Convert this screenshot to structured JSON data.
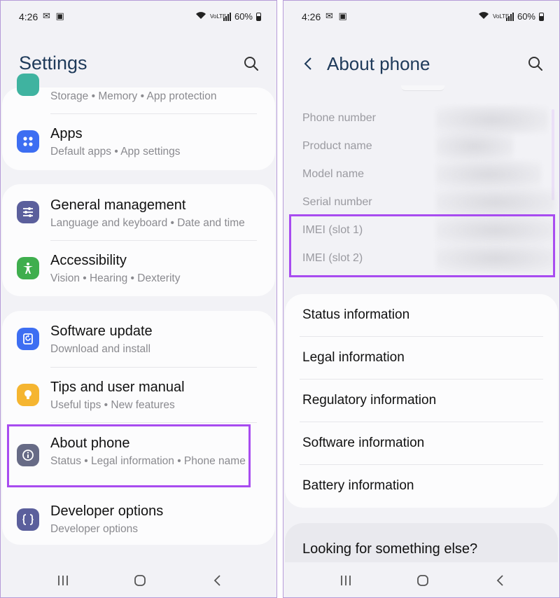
{
  "status_bar": {
    "time": "4:26",
    "notif_icons": "✉ ▣",
    "volte": "VoLTE",
    "battery": "60%"
  },
  "left": {
    "title": "Settings",
    "items": [
      {
        "subtitle": "Storage  •  Memory  •  App protection"
      },
      {
        "title": "Apps",
        "subtitle": "Default apps  •  App settings",
        "icon": "apps-icon",
        "color": "#3d6ef2"
      },
      {
        "title": "General management",
        "subtitle": "Language and keyboard  •  Date and time",
        "icon": "sliders-icon",
        "color": "#5b5f9c"
      },
      {
        "title": "Accessibility",
        "subtitle": "Vision  •  Hearing  •  Dexterity",
        "icon": "accessibility-icon",
        "color": "#3fae4e"
      },
      {
        "title": "Software update",
        "subtitle": "Download and install",
        "icon": "update-icon",
        "color": "#3d6ef2"
      },
      {
        "title": "Tips and user manual",
        "subtitle": "Useful tips  •  New features",
        "icon": "lightbulb-icon",
        "color": "#f5b530"
      },
      {
        "title": "About phone",
        "subtitle": "Status  •  Legal information  •  Phone name",
        "icon": "info-icon",
        "color": "#676b86"
      },
      {
        "title": "Developer options",
        "subtitle": "Developer options",
        "icon": "braces-icon",
        "color": "#5b5f9c"
      }
    ]
  },
  "right": {
    "title": "About phone",
    "info": [
      "Phone number",
      "Product name",
      "Model name",
      "Serial number",
      "IMEI (slot 1)",
      "IMEI (slot 2)"
    ],
    "menu": [
      "Status information",
      "Legal information",
      "Regulatory information",
      "Software information",
      "Battery information"
    ],
    "looking": "Looking for something else?"
  },
  "colors": {
    "highlight": "#a84cf0",
    "title": "#1e3a5a"
  }
}
